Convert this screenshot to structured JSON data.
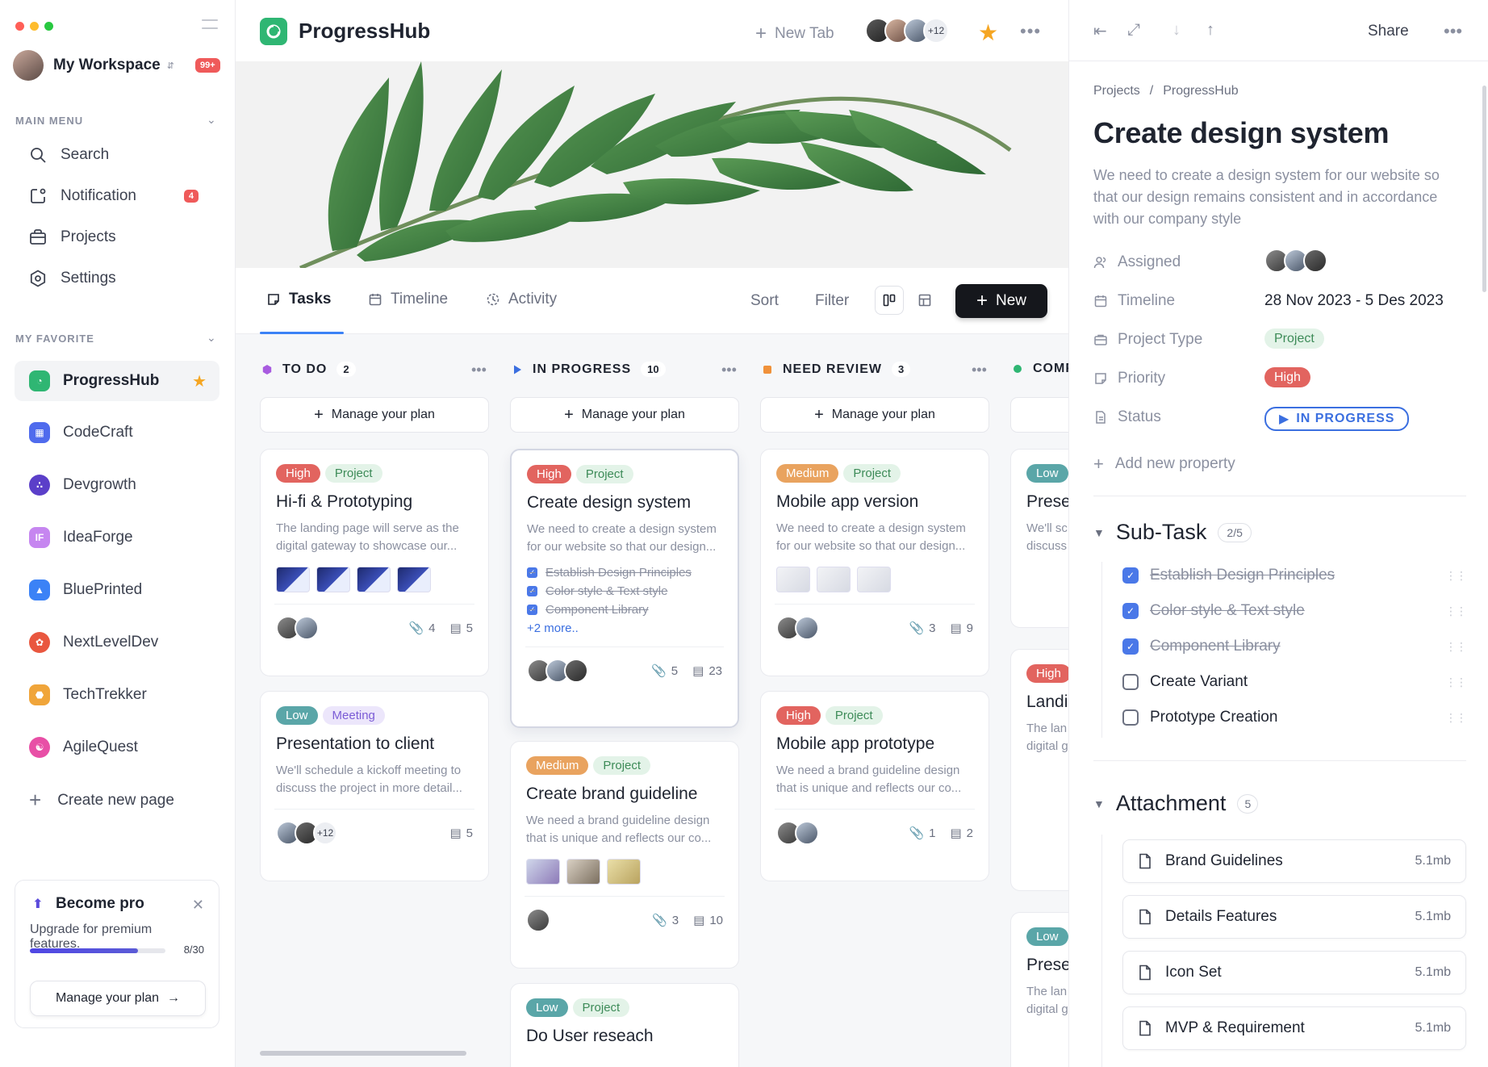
{
  "sidebar": {
    "workspace_name": "My Workspace",
    "notif_badge": "99+",
    "main_menu_label": "MAIN MENU",
    "main_menu": [
      {
        "label": "Search",
        "icon": "search-icon"
      },
      {
        "label": "Notification",
        "icon": "notification-icon",
        "count": "4"
      },
      {
        "label": "Projects",
        "icon": "briefcase-icon"
      },
      {
        "label": "Settings",
        "icon": "settings-icon"
      }
    ],
    "favorite_label": "MY FAVORITE",
    "favorites": [
      {
        "label": "ProgressHub",
        "color": "#2fb673",
        "active": true
      },
      {
        "label": "CodeCraft",
        "color": "#4f6bed"
      },
      {
        "label": "Devgrowth",
        "color": "#5b3fc9"
      },
      {
        "label": "IdeaForge",
        "color": "#c686f0"
      },
      {
        "label": "BluePrinted",
        "color": "#3b82f6"
      },
      {
        "label": "NextLevelDev",
        "color": "#e9573f"
      },
      {
        "label": "TechTrekker",
        "color": "#f0a53a"
      },
      {
        "label": "AgileQuest",
        "color": "#e84fa6"
      }
    ],
    "create_page": "Create new page",
    "pro": {
      "title": "Become pro",
      "subtitle": "Upgrade for premium features.",
      "progress": 0.8,
      "count": "8/30",
      "button": "Manage your plan"
    }
  },
  "topbar": {
    "app_title": "ProgressHub",
    "new_tab": "New Tab",
    "collaborators_more": "+12"
  },
  "tabs": {
    "items": [
      "Tasks",
      "Timeline",
      "Activity"
    ],
    "sort": "Sort",
    "filter": "Filter",
    "new_button": "New"
  },
  "board": {
    "manage_plan": "Manage your plan",
    "columns": [
      {
        "title": "TO DO",
        "count": "2",
        "color": "#a85be0",
        "cards": [
          {
            "tags": [
              [
                "High",
                "high"
              ],
              [
                "Project",
                "project"
              ]
            ],
            "title": "Hi-fi & Prototyping",
            "desc": "The landing page will serve as the digital gateway to showcase our...",
            "attach": "4",
            "comments": "5"
          },
          {
            "tags": [
              [
                "Low",
                "low"
              ],
              [
                "Meeting",
                "meeting"
              ]
            ],
            "title": "Presentation to client",
            "desc": "We'll schedule a kickoff meeting to discuss the project in more detail...",
            "avatars_more": "+12",
            "comments": "5"
          }
        ]
      },
      {
        "title": "IN PROGRESS",
        "count": "10",
        "color": "#3b6fe0",
        "cards": [
          {
            "tags": [
              [
                "High",
                "high"
              ],
              [
                "Project",
                "project"
              ]
            ],
            "title": "Create design system",
            "desc": "We need to create a design system for our website so that our design...",
            "checks": [
              "Establish Design Principles",
              "Color style & Text style",
              "Component Library"
            ],
            "more": "+2 more..",
            "attach": "5",
            "comments": "23"
          },
          {
            "tags": [
              [
                "Medium",
                "medium"
              ],
              [
                "Project",
                "project"
              ]
            ],
            "title": "Create brand guideline",
            "desc": "We need a brand guideline design that is unique and reflects our co...",
            "attach": "3",
            "comments": "10"
          },
          {
            "tags": [
              [
                "Low",
                "low"
              ],
              [
                "Project",
                "project"
              ]
            ],
            "title": "Do User reseach"
          }
        ]
      },
      {
        "title": "NEED REVIEW",
        "count": "3",
        "color": "#f0913a",
        "cards": [
          {
            "tags": [
              [
                "Medium",
                "medium"
              ],
              [
                "Project",
                "project"
              ]
            ],
            "title": "Mobile app version",
            "desc": "We need to create a design system for our website so that our design...",
            "attach": "3",
            "comments": "9"
          },
          {
            "tags": [
              [
                "High",
                "high"
              ],
              [
                "Project",
                "project"
              ]
            ],
            "title": "Mobile app prototype",
            "desc": "We need a brand guideline design that is unique and reflects our co...",
            "attach": "1",
            "comments": "2"
          }
        ]
      },
      {
        "title": "COMP",
        "color": "#2fb673",
        "cards": [
          {
            "tags": [
              [
                "Low",
                "low"
              ]
            ],
            "title": "Prese",
            "desc": "We'll sc discuss"
          },
          {
            "tags": [
              [
                "High",
                "high"
              ]
            ],
            "title": "Landi",
            "desc": "The lan digital g"
          },
          {
            "tags": [
              [
                "Low",
                "low"
              ]
            ],
            "title": "Prese",
            "desc": "The lan digital g"
          }
        ]
      }
    ]
  },
  "panel": {
    "share": "Share",
    "breadcrumb": [
      "Projects",
      "ProgressHub"
    ],
    "title": "Create design system",
    "description": "We need to create a design system for our website so that our design remains consistent and in accordance with our company style",
    "props": {
      "assigned": "Assigned",
      "timeline": "Timeline",
      "timeline_value": "28 Nov 2023 - 5 Des 2023",
      "project_type": "Project Type",
      "project_type_value": "Project",
      "priority": "Priority",
      "priority_value": "High",
      "status": "Status",
      "status_value": "IN PROGRESS"
    },
    "add_property": "Add new property",
    "subtask": {
      "title": "Sub-Task",
      "count": "2/5",
      "items": [
        {
          "label": "Establish Design Principles",
          "done": true
        },
        {
          "label": "Color style & Text style",
          "done": true
        },
        {
          "label": "Component Library",
          "done": true
        },
        {
          "label": "Create Variant",
          "done": false
        },
        {
          "label": "Prototype Creation",
          "done": false
        }
      ]
    },
    "attachment": {
      "title": "Attachment",
      "count": "5",
      "items": [
        {
          "name": "Brand Guidelines",
          "size": "5.1mb"
        },
        {
          "name": "Details Features",
          "size": "5.1mb"
        },
        {
          "name": "Icon Set",
          "size": "5.1mb"
        },
        {
          "name": "MVP & Requirement",
          "size": "5.1mb"
        }
      ]
    }
  }
}
